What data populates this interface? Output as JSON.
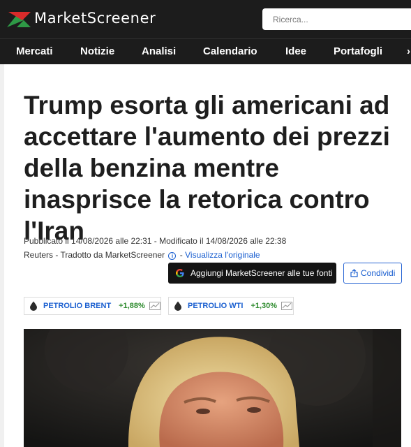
{
  "header": {
    "brand": "MarketScreener",
    "search_placeholder": "Ricerca..."
  },
  "nav": {
    "items": [
      "Mercati",
      "Notizie",
      "Analisi",
      "Calendario",
      "Idee",
      "Portafogli"
    ]
  },
  "article": {
    "title": "Trump esorta gli americani ad accettare l'aumento dei prezzi della benzina mentre inasprisce la retorica contro l'Iran",
    "published": "Pubblicato il 14/08/2026 alle 22:31 - Modificato il 14/08/2026 alle 22:38",
    "source_prefix": "Reuters - Tradotto da MarketScreener",
    "info_glyph": "i",
    "separator": "-",
    "original_link": "Visualizza l'originale",
    "google_button": "Aggiungi MarketScreener alle tue fonti",
    "share_button": "Condividi"
  },
  "tickers": [
    {
      "name": "PETROLIO BRENT",
      "change": "+1,88%"
    },
    {
      "name": "PETROLIO WTI",
      "change": "+1,30%"
    }
  ],
  "colors": {
    "topbar": "#1c1c1c",
    "link": "#1a5fd0",
    "positive": "#2e8b2e",
    "logo_red": "#d92b2b",
    "logo_green": "#2e9a46"
  },
  "icons": {
    "search": "none",
    "info": "info-icon",
    "google": "google-g-icon",
    "share": "share-icon",
    "oil": "oil-drop-icon",
    "chart": "line-chart-icon"
  }
}
